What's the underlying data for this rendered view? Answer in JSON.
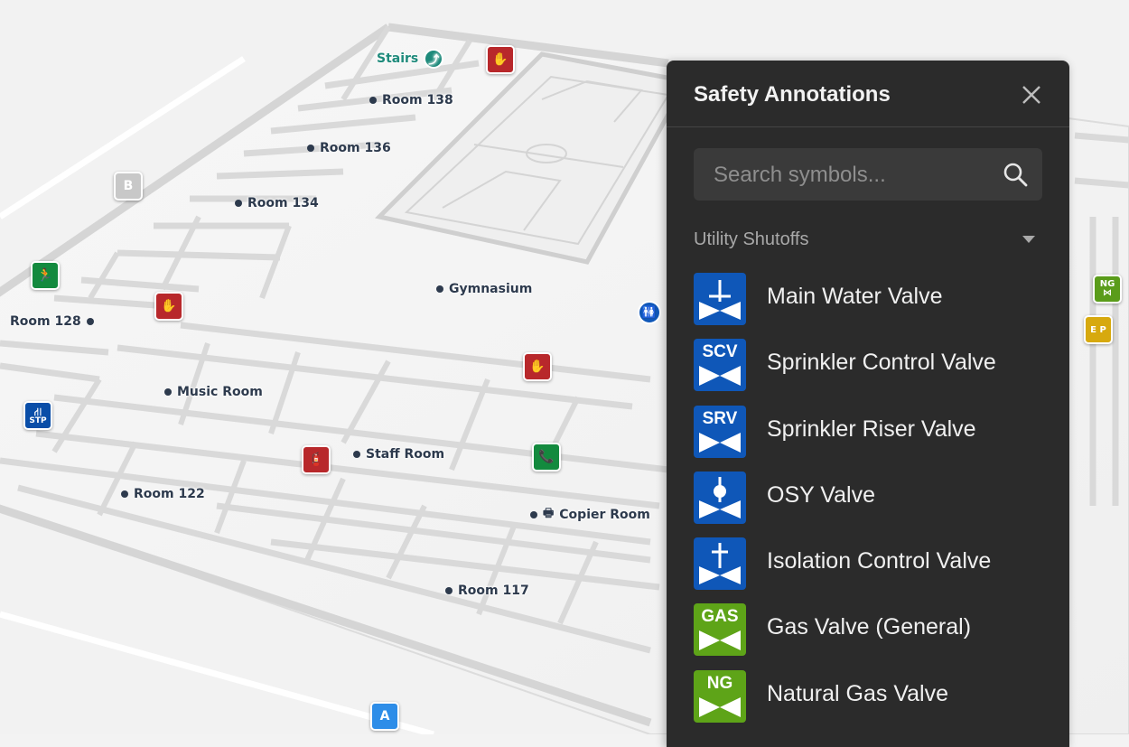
{
  "panel": {
    "title": "Safety Annotations",
    "search_placeholder": "Search symbols...",
    "section_label": "Utility Shutoffs",
    "items": [
      {
        "label": "Main Water Valve",
        "code": "",
        "icon": "main-water-valve-icon",
        "color": "#0f57b8"
      },
      {
        "label": "Sprinkler Control Valve",
        "code": "SCV",
        "icon": "scv-valve-icon",
        "color": "#0f57b8"
      },
      {
        "label": "Sprinkler Riser Valve",
        "code": "SRV",
        "icon": "srv-valve-icon",
        "color": "#0f57b8"
      },
      {
        "label": "OSY Valve",
        "code": "",
        "icon": "osy-valve-icon",
        "color": "#0f57b8"
      },
      {
        "label": "Isolation Control Valve",
        "code": "",
        "icon": "isolation-valve-icon",
        "color": "#0f57b8"
      },
      {
        "label": "Gas Valve (General)",
        "code": "GAS",
        "icon": "gas-valve-icon",
        "color": "#5ea418"
      },
      {
        "label": "Natural Gas Valve",
        "code": "NG",
        "icon": "natural-gas-valve-icon",
        "color": "#5ea418"
      }
    ]
  },
  "map": {
    "rooms": {
      "stairs": "Stairs",
      "room138": "Room 138",
      "room136": "Room 136",
      "room134": "Room 134",
      "gymnasium": "Gymnasium",
      "room128": "Room 128",
      "music_room": "Music Room",
      "staff_room": "Staff Room",
      "room122": "Room 122",
      "copier_room": "Copier Room",
      "room117": "Room 117"
    },
    "markers": {
      "building_b": "B",
      "building_a": "A",
      "stp": "STP",
      "ng": "NG",
      "ep": "E P"
    }
  }
}
